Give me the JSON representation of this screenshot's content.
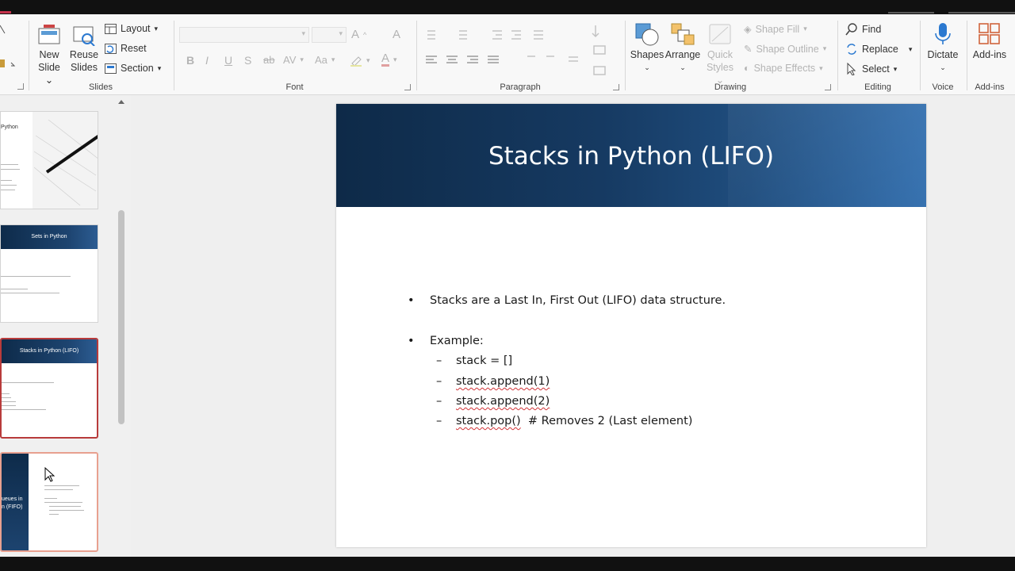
{
  "ribbon": {
    "slides_group": {
      "label": "Slides",
      "new_slide_line1": "New",
      "new_slide_line2": "Slide",
      "reuse_line1": "Reuse",
      "reuse_line2": "Slides",
      "layout": "Layout",
      "reset": "Reset",
      "section": "Section"
    },
    "font_group": {
      "label": "Font",
      "bold": "B",
      "italic": "I",
      "underline": "U",
      "shadow": "S",
      "strike": "ab",
      "spacing": "AV",
      "case": "Aa",
      "grow": "A",
      "font_color": "A"
    },
    "paragraph_group": {
      "label": "Paragraph"
    },
    "drawing_group": {
      "label": "Drawing",
      "shapes": "Shapes",
      "arrange": "Arrange",
      "quick_line1": "Quick",
      "quick_line2": "Styles",
      "shape_fill": "Shape Fill",
      "shape_outline": "Shape Outline",
      "shape_effects": "Shape Effects"
    },
    "editing_group": {
      "label": "Editing",
      "find": "Find",
      "replace": "Replace",
      "select": "Select"
    },
    "voice_group": {
      "label": "Voice",
      "dictate": "Dictate"
    },
    "addins_group": {
      "label": "Add-ins",
      "addins": "Add-ins"
    }
  },
  "thumbnails": [
    {
      "title": "Python"
    },
    {
      "title": "Sets in Python"
    },
    {
      "title": "Stacks in Python (LIFO)"
    },
    {
      "title_line1": "ueues in",
      "title_line2": "n (FIFO)"
    }
  ],
  "slide": {
    "title": "Stacks in Python (LIFO)",
    "bullet1": "Stacks are a Last In, First Out (LIFO) data structure.",
    "bullet2": "Example:",
    "sub_dash": "–",
    "sub1": "stack = []",
    "sub2": "stack.append(1)",
    "sub3": "stack.append(2)",
    "sub4_code": "stack.pop()",
    "sub4_comment": "  # Removes 2 (Last element)"
  },
  "colors": {
    "accent": "#c4314b",
    "slide_header_dark": "#0e2a48",
    "slide_header_light": "#3772b0",
    "dictate_blue": "#2b79d0"
  }
}
